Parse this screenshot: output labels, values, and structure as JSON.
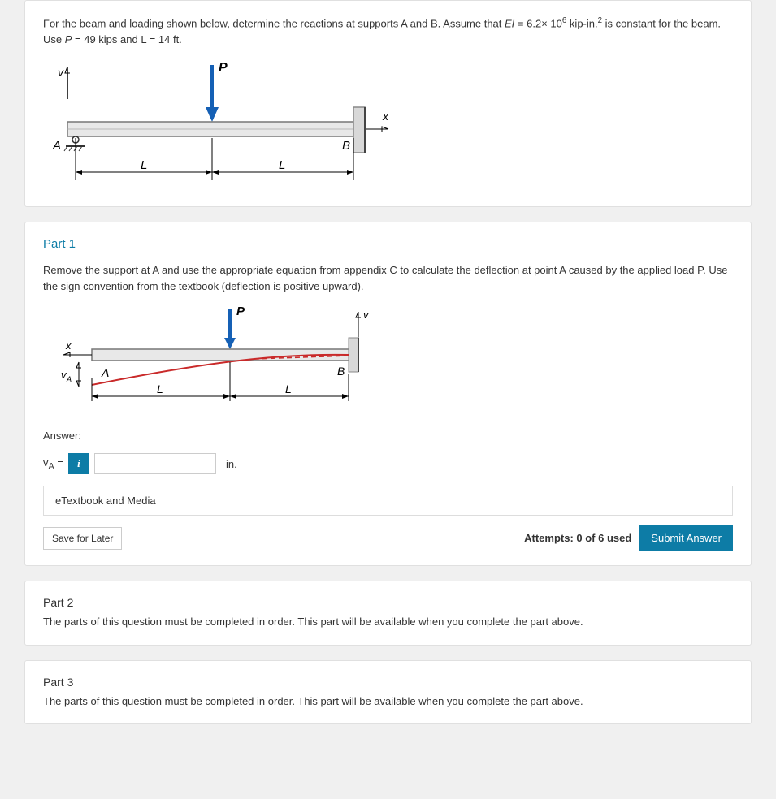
{
  "question": {
    "intro_html": "For the beam and loading shown below, determine the reactions at supports A and B. Assume that <span class='var'>EI</span> = 6.2× 10<sup>6</sup> kip-in.<sup>2</sup> is constant for the beam. Use <span class='var'>P</span> = 49 kips and L = 14 ft.",
    "diagram1": {
      "A": "A",
      "B": "B",
      "P": "P",
      "L": "L",
      "x": "x",
      "v": "v"
    }
  },
  "part1": {
    "title": "Part 1",
    "instruction": "Remove the support at A and use the appropriate equation from appendix C to calculate the deflection at point A caused by the applied load P. Use the sign convention from the textbook (deflection is positive upward).",
    "diagram2": {
      "A": "A",
      "B": "B",
      "P": "P",
      "L": "L",
      "x": "x",
      "v": "v",
      "vA": "v<sub>A</sub>"
    },
    "answer_label": "Answer:",
    "field_label_html": "v<sub>A</sub> =",
    "field_value": "",
    "unit": "in.",
    "etextbook": "eTextbook and Media",
    "save": "Save for Later",
    "attempts": "Attempts: 0 of 6 used",
    "submit": "Submit Answer"
  },
  "part2": {
    "title": "Part 2",
    "locked": "The parts of this question must be completed in order. This part will be available when you complete the part above."
  },
  "part3": {
    "title": "Part 3",
    "locked": "The parts of this question must be completed in order. This part will be available when you complete the part above."
  }
}
